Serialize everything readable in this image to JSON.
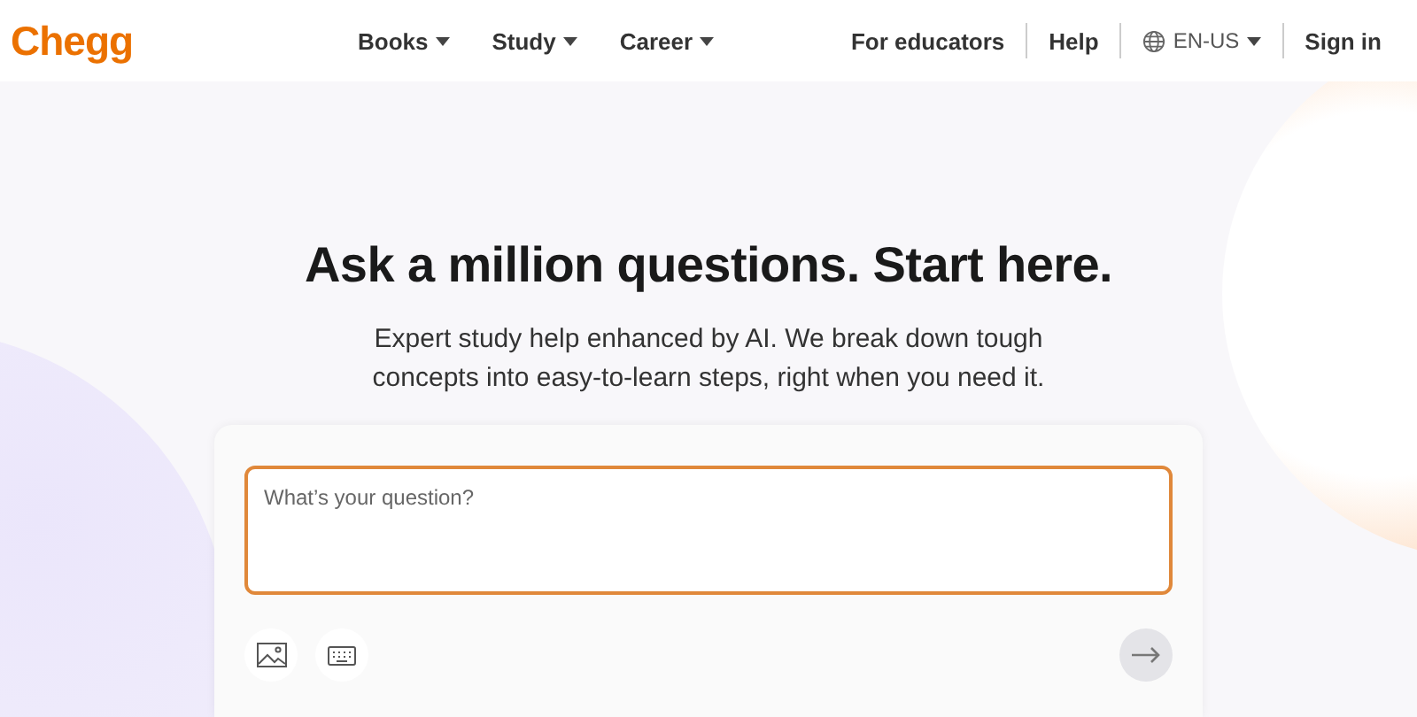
{
  "header": {
    "logo": "Chegg",
    "nav": [
      {
        "label": "Books",
        "caret": true
      },
      {
        "label": "Study",
        "caret": true
      },
      {
        "label": "Career",
        "caret": true
      }
    ],
    "right_links": [
      {
        "kind": "link",
        "label": "For educators"
      },
      {
        "kind": "link",
        "label": "Help"
      },
      {
        "kind": "language",
        "label": "EN-US"
      },
      {
        "kind": "link",
        "label": "Sign in"
      }
    ]
  },
  "hero": {
    "title": "Ask a million questions. Start here.",
    "subtitle": "Expert study help enhanced by AI. We break down tough concepts into easy-to-learn steps, right when you need it."
  },
  "ask_card": {
    "placeholder": "What’s your question?",
    "send_button": {
      "disabled": true
    }
  }
}
